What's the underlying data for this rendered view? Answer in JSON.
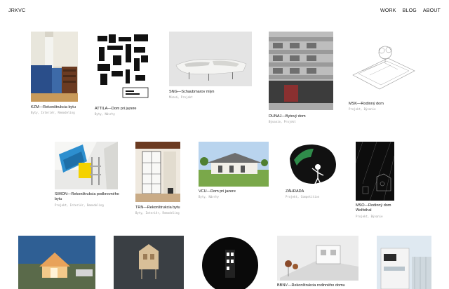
{
  "header": {
    "brand": "JRKVC"
  },
  "nav": {
    "work": "WORK",
    "blog": "BLOG",
    "about": "ABOUT"
  },
  "projects": [
    {
      "title": "KZM—Rekonštrukcia bytu",
      "title2": "",
      "tags": "Byty, Interiér, Remodeling"
    },
    {
      "title": "ATTILA—Dom pri jazere",
      "title2": "",
      "tags": "Byty, Návrhy"
    },
    {
      "title": "SNG—Schaubmarov mlyn",
      "title2": "",
      "tags": "Múzeá, Projekt"
    },
    {
      "title": "DUNAJ—Bytový dom",
      "title2": "",
      "tags": "Bývanie, Projekt"
    },
    {
      "title": "MSK—Rodinný dom",
      "title2": "",
      "tags": "Projekt, Bývanie"
    },
    {
      "title": "SIMON—Rekonštrukcia podkrovného",
      "title2": "bytu",
      "tags": "Projekt, Interiér, Remodeling"
    },
    {
      "title": "TRN—Rekonštrukcia bytu",
      "title2": "",
      "tags": "Byty, Interiér, Remodeling"
    },
    {
      "title": "VCU—Dom pri jazere",
      "title2": "",
      "tags": "Byty, Návrhy"
    },
    {
      "title": "ZÁHRADA",
      "title2": "",
      "tags": "Projekt, Competition"
    },
    {
      "title": "MSO—Rodinný dom",
      "title2": "Wolfsthal",
      "tags": "Projekt, Bývanie"
    },
    {
      "title": "",
      "title2": "",
      "tags": ""
    },
    {
      "title": "",
      "title2": "",
      "tags": ""
    },
    {
      "title": "",
      "title2": "",
      "tags": ""
    },
    {
      "title": "BBNV—Rekonštrukcia rodinného domu",
      "title2": "",
      "tags": ""
    },
    {
      "title": "",
      "title2": "",
      "tags": ""
    }
  ]
}
